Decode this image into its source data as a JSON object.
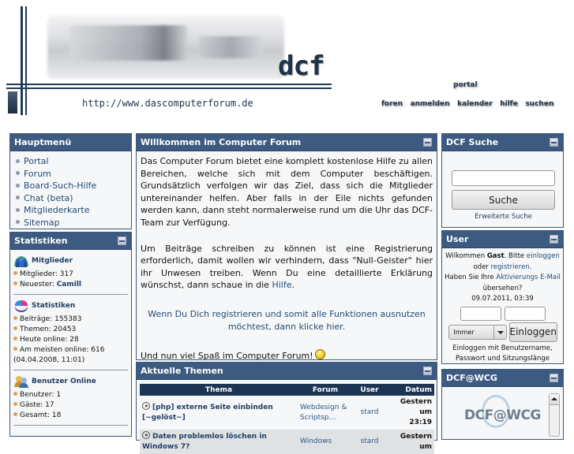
{
  "header": {
    "logo_text": "dcf",
    "site_url": "http://www.dascomputerforum.de",
    "nav_top": "portal",
    "nav_links": [
      "foren",
      "anmelden",
      "kalender",
      "hilfe",
      "suchen"
    ]
  },
  "hauptmenu": {
    "title": "Hauptmenü",
    "items": [
      "Portal",
      "Forum",
      "Board-Such-Hilfe",
      "Chat (beta)",
      "Mitgliederkarte",
      "Sitemap"
    ]
  },
  "statistiken": {
    "title": "Statistiken",
    "members": {
      "title": "Mitglieder",
      "count_label": "Mitglieder: 317",
      "newest_prefix": "Neuester: ",
      "newest_user": "Camill"
    },
    "stats": {
      "title": "Statistiken",
      "posts": "Beiträge: 155383",
      "topics": "Themen: 20453",
      "today_online": "Heute online: 28",
      "max_online": "Am meisten online: 616",
      "max_online_date": "(04.04.2008, 11:01)"
    },
    "online": {
      "title": "Benutzer Online",
      "users": "Benutzer: 1",
      "guests": "Gäste: 17",
      "total": "Gesamt: 18"
    }
  },
  "welcome": {
    "title": "Willkommen im Computer Forum",
    "para1": "Das Computer Forum bietet eine komplett kostenlose Hilfe zu allen Bereichen, welche sich mit dem Computer beschäftigen. Grundsätzlich verfolgen wir das Ziel, dass sich die Mitglieder untereinander helfen. Aber falls in der Eile nichts gefunden werden kann, dann steht normalerweise rund um die Uhr das DCF-Team zur Verfügung.",
    "para2_before": "Um Beiträge schreiben zu können ist eine Registrierung erforderlich, damit wollen wir verhindern, dass \"Null-Geister\" hier ihr Unwesen treiben. Wenn Du eine detaillierte Erklärung wünschst, dann schaue in die ",
    "para2_link": "Hilfe",
    "para2_after": ".",
    "register_link": "Wenn Du Dich registrieren und somit alle Funktionen ausnutzen möchtest, dann klicke hier.",
    "closing": "Und nun viel Spaß im Computer Forum!"
  },
  "themes": {
    "title": "Aktuelle Themen",
    "columns": [
      "Thema",
      "Forum",
      "User",
      "Datum"
    ],
    "rows": [
      {
        "topic": "[php] externe Seite einbinden [~gelöst~]",
        "forum": "Webdesign & Scriptsp...",
        "user": "stard",
        "date_line1": "Gestern um",
        "date_line2": "23:19"
      },
      {
        "topic": "Daten problemlos löschen in Windows 7?",
        "forum": "Windows",
        "user": "stard",
        "date_line1": "Gestern um",
        "date_line2": ""
      }
    ]
  },
  "search": {
    "title": "DCF Suche",
    "input_value": "",
    "button_label": "Suche",
    "advanced_link": "Erweiterte Suche"
  },
  "user": {
    "title": "User",
    "welcome_text": "Wilkommen ",
    "guest": "Gast",
    "please": ". Bitte ",
    "login_link": "einloggen",
    "or": "oder ",
    "register_link": "registrieren",
    "period": ".",
    "activation_prefix": "Haben Sie Ihre ",
    "activation_link": "Aktivierungs E-Mail",
    "activation_suffix": "übersehen?",
    "datetime": "09.07.2011, 03:39",
    "username_value": "",
    "password_value": "",
    "session_select": "Immer",
    "login_button": "Einloggen",
    "hint": "Einloggen mit Benutzername, Passwort und Sitzungslänge"
  },
  "wcg": {
    "title": "DCF@WCG",
    "logo_text": "DCF@WCG"
  },
  "colors": {
    "panel_header": "#3d5a80",
    "table_header": "#1b3552",
    "link": "#1f4b75",
    "bullet": "#d9a45c"
  }
}
